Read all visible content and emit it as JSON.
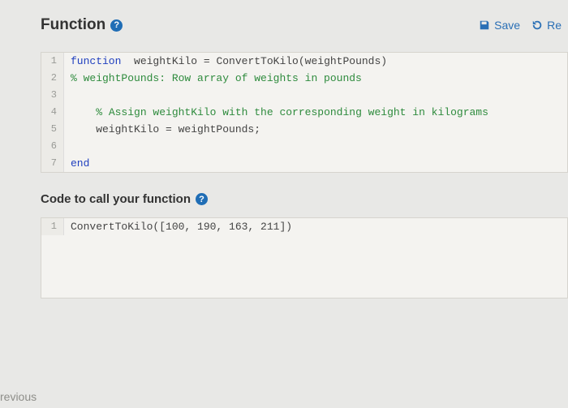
{
  "header": {
    "title": "Function",
    "save_label": "Save",
    "reset_label": "Re"
  },
  "function_code": {
    "lines": [
      {
        "n": "1",
        "pre": "",
        "kw": "function",
        "rest": "  weightKilo = ConvertToKilo(weightPounds)"
      },
      {
        "n": "2",
        "pre": "",
        "kw": "",
        "rest": "",
        "comment": "% weightPounds: Row array of weights in pounds"
      },
      {
        "n": "3",
        "pre": "",
        "kw": "",
        "rest": ""
      },
      {
        "n": "4",
        "pre": "    ",
        "kw": "",
        "rest": "",
        "comment": "% Assign weightKilo with the corresponding weight in kilograms"
      },
      {
        "n": "5",
        "pre": "    weightKilo = weightPounds;",
        "kw": "",
        "rest": ""
      },
      {
        "n": "6",
        "pre": "",
        "kw": "",
        "rest": ""
      },
      {
        "n": "7",
        "pre": "",
        "kw": "end",
        "rest": ""
      }
    ]
  },
  "call_section": {
    "title": "Code to call your function"
  },
  "call_code": {
    "lines": [
      {
        "n": "1",
        "text": "ConvertToKilo([100, 190, 163, 211])"
      }
    ]
  },
  "nav": {
    "previous": "revious"
  }
}
